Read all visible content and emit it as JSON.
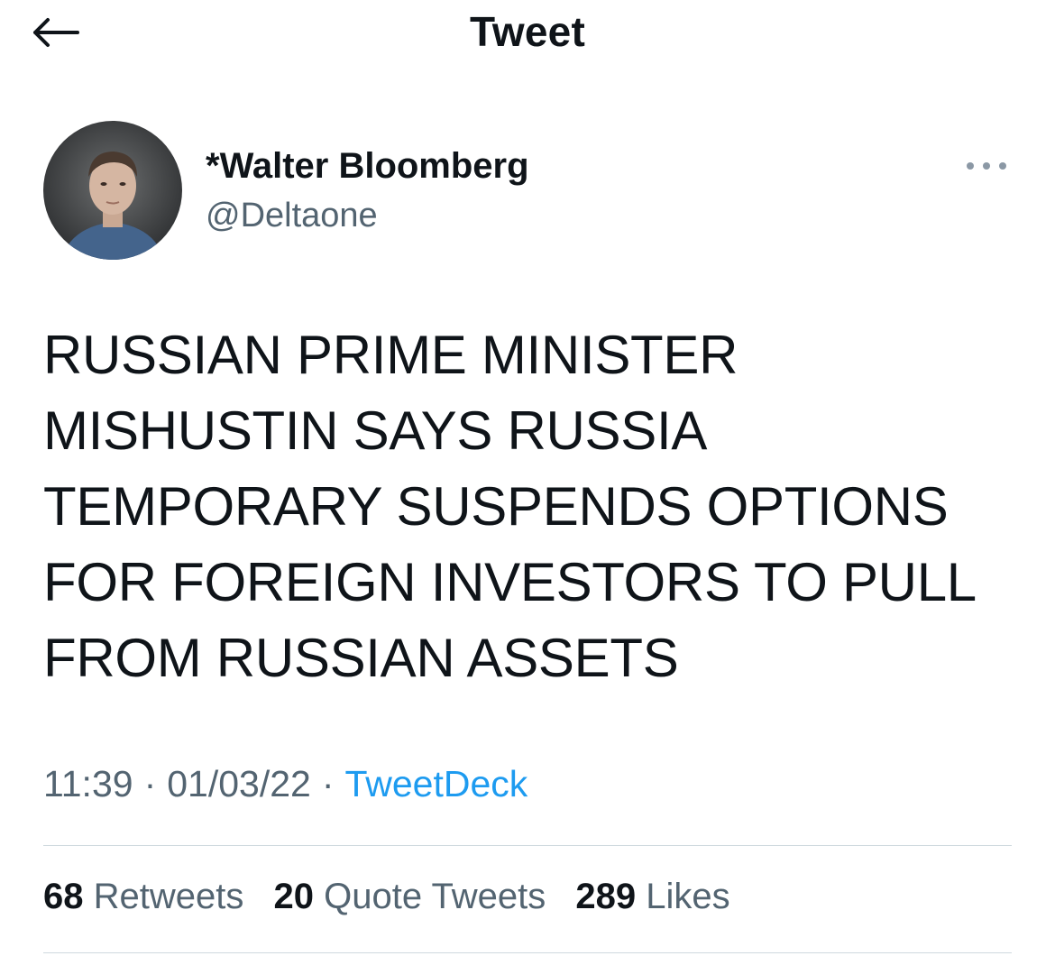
{
  "header": {
    "back_icon": "arrow-left-icon",
    "title": "Tweet"
  },
  "author": {
    "display_name": "*Walter Bloomberg",
    "handle": "@Deltaone",
    "avatar_icon": "user-avatar"
  },
  "more_icon": "more-horizontal-icon",
  "tweet": {
    "lines": [
      "RUSSIAN PRIME MINISTER",
      "MISHUSTIN SAYS RUSSIA",
      "TEMPORARY SUSPENDS OPTIONS",
      "FOR FOREIGN INVESTORS TO PULL",
      "FROM RUSSIAN ASSETS"
    ],
    "time": "11:39",
    "date": "01/03/22",
    "separator": "·",
    "source": "TweetDeck"
  },
  "stats": {
    "retweets_count": "68",
    "retweets_label": "Retweets",
    "quotes_count": "20",
    "quotes_label": "Quote Tweets",
    "likes_count": "289",
    "likes_label": "Likes"
  },
  "colors": {
    "text": "#0f1419",
    "secondary": "#536471",
    "link": "#1d9bf0",
    "divider": "#cfd9de"
  }
}
